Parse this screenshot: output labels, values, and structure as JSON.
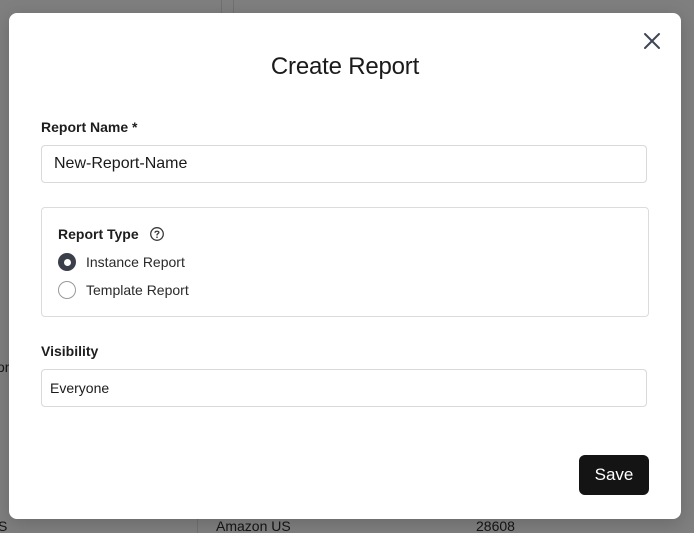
{
  "background": {
    "left_partial": "on",
    "bottom_left_partial": "S",
    "row_vendor": "Amazon US",
    "row_value": "28608"
  },
  "modal": {
    "title": "Create Report",
    "report_name": {
      "label": "Report Name *",
      "value": "New-Report-Name"
    },
    "report_type": {
      "label": "Report Type",
      "help_icon": "question-circle-icon",
      "options": [
        {
          "label": "Instance Report",
          "selected": true
        },
        {
          "label": "Template Report",
          "selected": false
        }
      ]
    },
    "visibility": {
      "label": "Visibility",
      "value": "Everyone"
    },
    "save_label": "Save",
    "close_icon": "close-icon"
  },
  "colors": {
    "primary_button": "#141414",
    "radio_checked": "#3b3f4a"
  }
}
